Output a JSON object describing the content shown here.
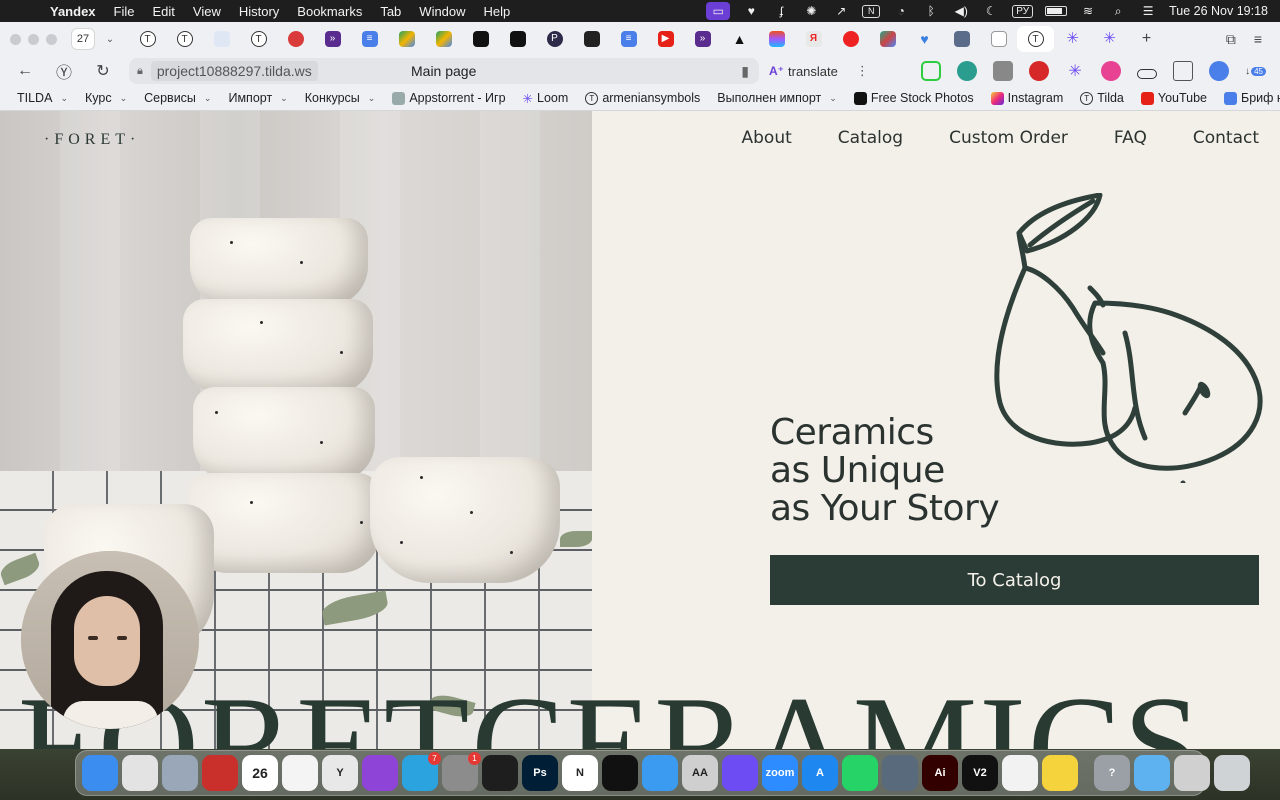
{
  "menubar": {
    "app_name": "Yandex",
    "items": [
      "File",
      "Edit",
      "View",
      "History",
      "Bookmarks",
      "Tab",
      "Window",
      "Help"
    ],
    "language": "РУ",
    "datetime": "Tue 26 Nov  19:18"
  },
  "browser": {
    "tab_count": "27",
    "url_domain": "project10888297.tilda.ws",
    "page_title": "Main page",
    "translate_label": "translate",
    "extension_badge": "45"
  },
  "bookmarks": [
    {
      "label": "TILDA",
      "dropdown": true
    },
    {
      "label": "Курс",
      "dropdown": true
    },
    {
      "label": "Сервисы",
      "dropdown": true
    },
    {
      "label": "Импорт",
      "dropdown": true
    },
    {
      "label": "Конкурсы",
      "dropdown": true
    },
    {
      "label": "Appstorrent - Игр",
      "dropdown": false
    },
    {
      "label": "Loom",
      "dropdown": false
    },
    {
      "label": "armeniansymbols",
      "dropdown": false
    },
    {
      "label": "Выполнен импорт",
      "dropdown": true
    },
    {
      "label": "Free Stock Photos",
      "dropdown": false
    },
    {
      "label": "Instagram",
      "dropdown": false
    },
    {
      "label": "Tilda",
      "dropdown": false
    },
    {
      "label": "YouTube",
      "dropdown": false
    },
    {
      "label": "Бриф на р",
      "dropdown": false
    }
  ],
  "site": {
    "logo": "·FORET·",
    "nav": [
      "About",
      "Catalog",
      "Custom Order",
      "FAQ",
      "Contact"
    ],
    "headline": [
      "Ceramics",
      "as Unique",
      "as Your Story"
    ],
    "cta_label": "To Catalog",
    "big_word": "FORETCERAMICS",
    "colors": {
      "background": "#f3efe9",
      "accent": "#2b3b36",
      "text": "#2a3330"
    }
  },
  "dock": {
    "apps": [
      {
        "name": "Finder",
        "label": "",
        "color": "#3b8ef0"
      },
      {
        "name": "Chrome",
        "label": "",
        "color": "#e3e3e3"
      },
      {
        "name": "Launchpad",
        "label": "",
        "color": "#9aa7b8"
      },
      {
        "name": "Acrobat",
        "label": "",
        "color": "#c9302c"
      },
      {
        "name": "Calendar",
        "label": "26",
        "color": "#ffffff"
      },
      {
        "name": "Notes",
        "label": "",
        "color": "#f4f4f4"
      },
      {
        "name": "Yandex",
        "label": "Y",
        "color": "#e8e8e8"
      },
      {
        "name": "Podcasts",
        "label": "",
        "color": "#8e44d6"
      },
      {
        "name": "Telegram",
        "label": "",
        "color": "#2aa3de",
        "badge": "7"
      },
      {
        "name": "System Settings",
        "label": "",
        "color": "#8c8c8c",
        "badge": "1"
      },
      {
        "name": "Figma",
        "label": "",
        "color": "#1e1e1e"
      },
      {
        "name": "Photoshop",
        "label": "Ps",
        "color": "#001e36"
      },
      {
        "name": "Notion",
        "label": "N",
        "color": "#ffffff"
      },
      {
        "name": "CapCut",
        "label": "",
        "color": "#111111"
      },
      {
        "name": "Safari",
        "label": "",
        "color": "#3a9bf0"
      },
      {
        "name": "Font Book",
        "label": "AA",
        "color": "#cfcfcf"
      },
      {
        "name": "Loom",
        "label": "",
        "color": "#6e4cf3"
      },
      {
        "name": "Zoom",
        "label": "zoom",
        "color": "#2d8cff"
      },
      {
        "name": "App Store",
        "label": "A",
        "color": "#1e88f0"
      },
      {
        "name": "WhatsApp",
        "label": "",
        "color": "#25d366"
      },
      {
        "name": "QuickTime",
        "label": "",
        "color": "#596a7c"
      },
      {
        "name": "Illustrator",
        "label": "Ai",
        "color": "#330000"
      },
      {
        "name": "VPN",
        "label": "V2",
        "color": "#111111"
      },
      {
        "name": "Photos",
        "label": "",
        "color": "#f2f2f2"
      },
      {
        "name": "Notes Yellow",
        "label": "",
        "color": "#f5d33d"
      },
      {
        "name": "Help",
        "label": "?",
        "color": "#9aa0a6"
      },
      {
        "name": "Downloads",
        "label": "",
        "color": "#5fb2f0"
      },
      {
        "name": "Preview Stack",
        "label": "",
        "color": "#d0d0d0"
      },
      {
        "name": "Trash",
        "label": "",
        "color": "#cfd3d6"
      }
    ]
  }
}
